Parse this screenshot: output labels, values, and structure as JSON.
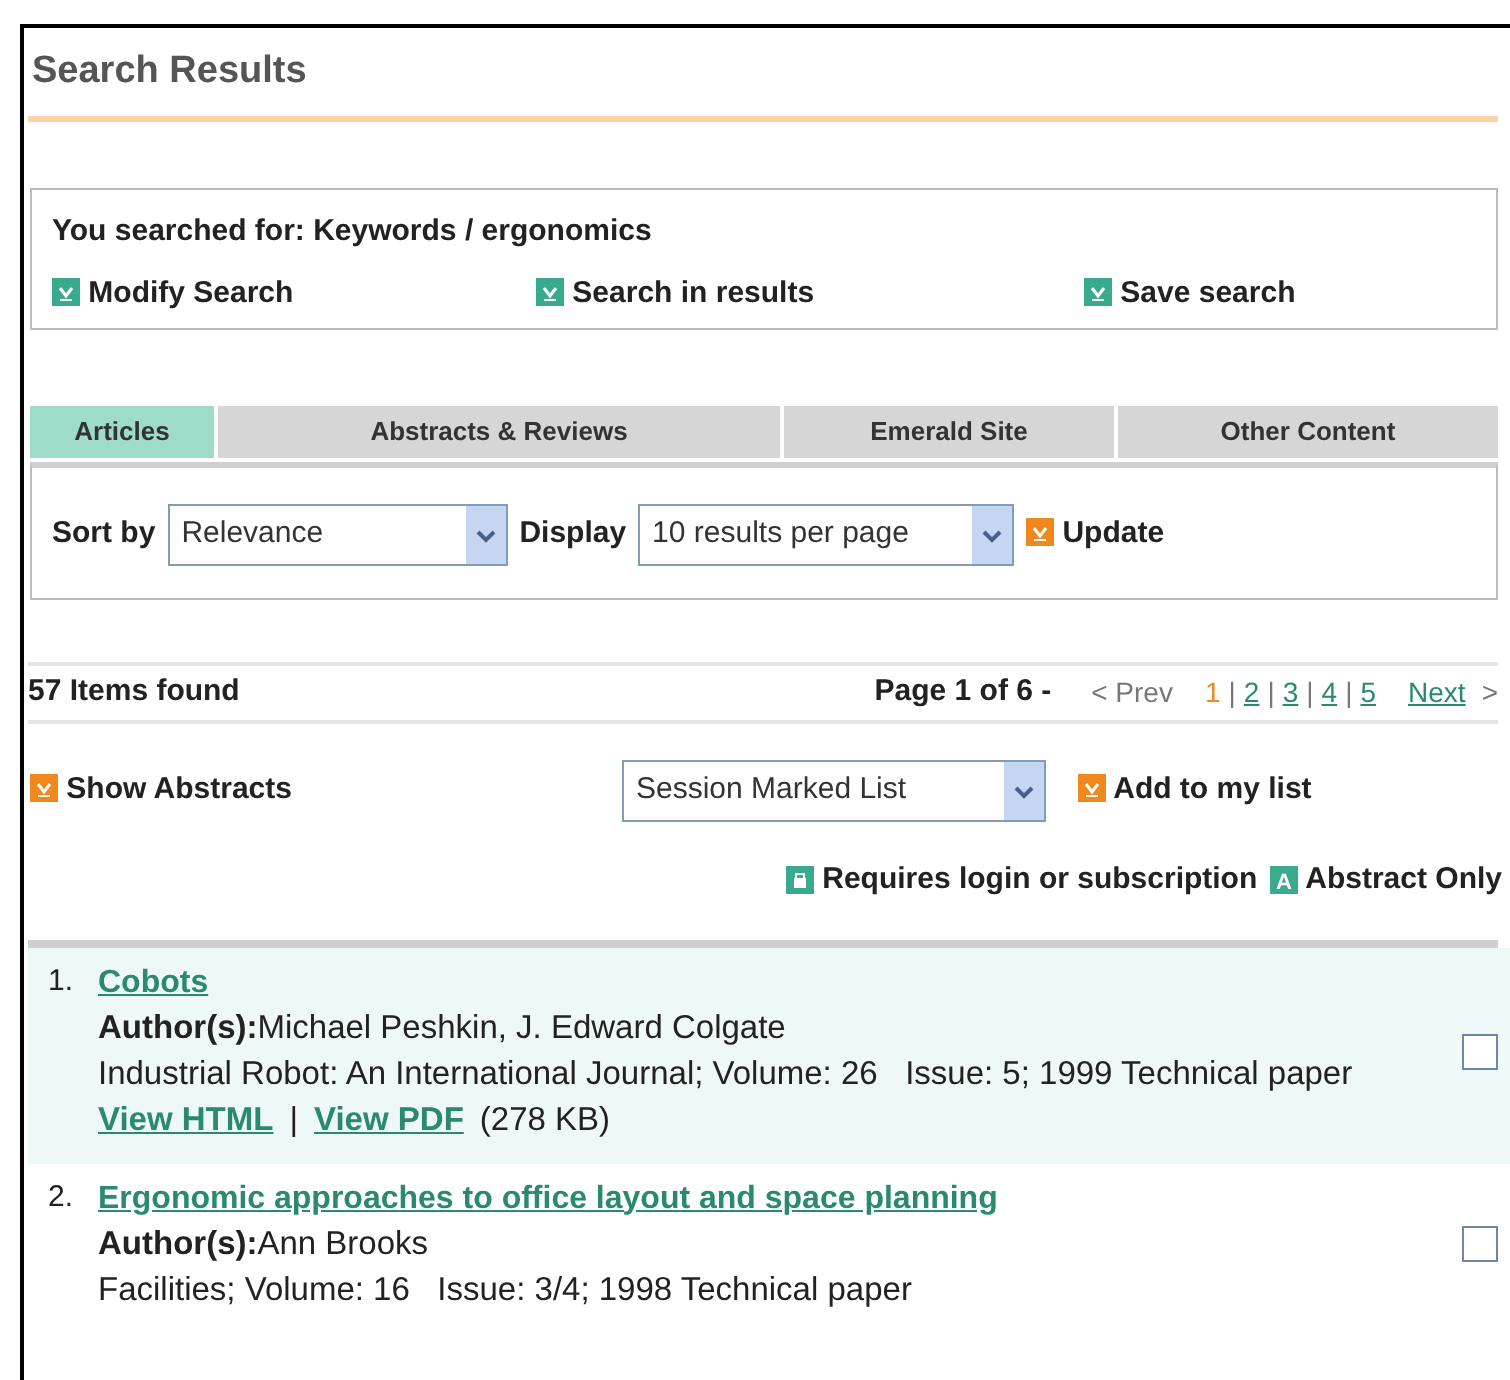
{
  "title": "Search Results",
  "query": "You searched for: Keywords / ergonomics",
  "search_actions": [
    {
      "label": "Modify Search"
    },
    {
      "label": "Search in results"
    },
    {
      "label": "Save search"
    }
  ],
  "tabs": [
    {
      "label": "Articles",
      "selected": true
    },
    {
      "label": "Abstracts & Reviews",
      "selected": false
    },
    {
      "label": "Emerald Site",
      "selected": false
    },
    {
      "label": "Other Content",
      "selected": false
    }
  ],
  "sort": {
    "label": "Sort by",
    "value": "Relevance"
  },
  "display": {
    "label": "Display",
    "value": "10 results per page"
  },
  "update": "Update",
  "count": "57 Items found",
  "pagination": {
    "summary": "Page 1 of 6 -",
    "prev": "< Prev",
    "separator": "|",
    "pages": [
      {
        "label": "1",
        "selected": true
      },
      {
        "label": "2",
        "selected": false
      },
      {
        "label": "3",
        "selected": false
      },
      {
        "label": "4",
        "selected": false
      },
      {
        "label": "5",
        "selected": false
      }
    ],
    "next": "Next",
    "next_arrow": ">"
  },
  "show_abstracts": "Show Abstracts",
  "list_select": "Session Marked List",
  "add_to_list": "Add to my list",
  "legend": [
    {
      "kind": "login",
      "label": "Requires login or subscription"
    },
    {
      "kind": "abstract",
      "badge": "A",
      "label": "Abstract Only"
    }
  ],
  "results": [
    {
      "number": "1.",
      "title": "Cobots",
      "authors_label": "Author(s):",
      "authors": "Michael Peshkin, J. Edward Colgate",
      "source": "Industrial Robot: An International Journal; Volume: 26   Issue: 5; 1999 Technical paper",
      "links": [
        "View HTML",
        "View PDF"
      ],
      "link_separator": "|",
      "size": "(278 KB)",
      "highlighted": true,
      "checked": false
    },
    {
      "number": "2.",
      "title": "Ergonomic approaches to office layout and space planning",
      "authors_label": "Author(s):",
      "authors": "Ann Brooks",
      "source": "Facilities; Volume: 16   Issue: 3/4; 1998 Technical paper",
      "highlighted": false,
      "checked": false
    }
  ]
}
